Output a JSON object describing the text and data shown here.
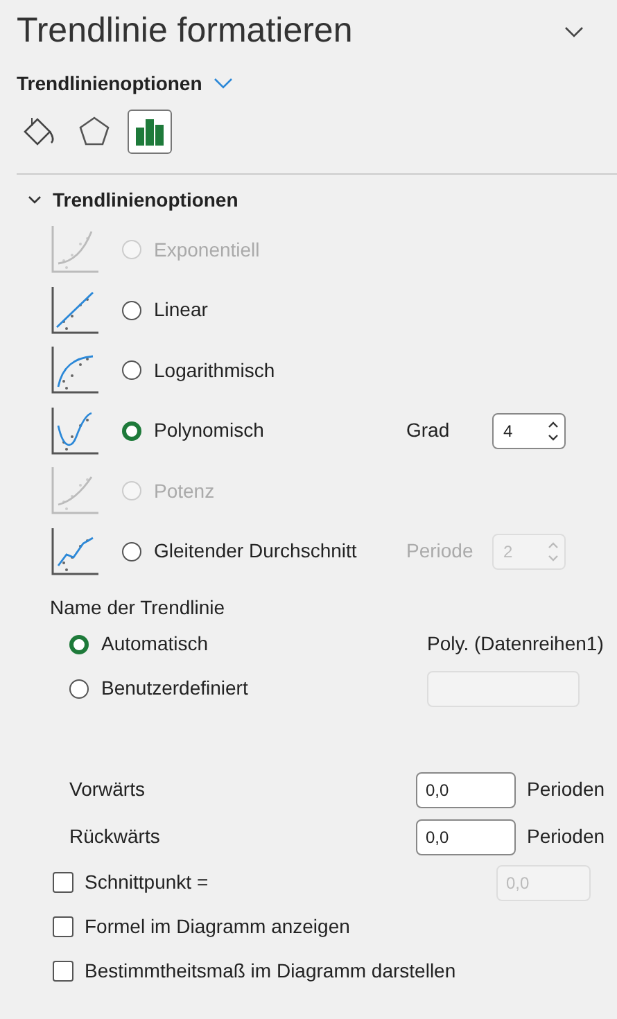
{
  "title": "Trendlinie formatieren",
  "subtitle": "Trendlinienoptionen",
  "tab_icons": [
    {
      "kind": "fill",
      "selected": false
    },
    {
      "kind": "shape",
      "selected": false
    },
    {
      "kind": "chart",
      "selected": true
    }
  ],
  "section": {
    "title": "Trendlinienoptionen",
    "expanded": true
  },
  "trend_types": [
    {
      "kind": "exponential",
      "label": "Exponentiell",
      "selected": false,
      "disabled": true
    },
    {
      "kind": "linear",
      "label": "Linear",
      "selected": false,
      "disabled": false
    },
    {
      "kind": "logarithmic",
      "label": "Logarithmisch",
      "selected": false,
      "disabled": false
    },
    {
      "kind": "polynomial",
      "label": "Polynomisch",
      "selected": true,
      "disabled": false,
      "param": {
        "label": "Grad",
        "value": "4",
        "disabled": false
      }
    },
    {
      "kind": "power",
      "label": "Potenz",
      "selected": false,
      "disabled": true
    },
    {
      "kind": "moving_average",
      "label": "Gleitender Durchschnitt",
      "selected": false,
      "disabled": false,
      "param": {
        "label": "Periode",
        "value": "2",
        "disabled": true
      }
    }
  ],
  "name_label": "Name der Trendlinie",
  "name_options": [
    {
      "label": "Automatisch",
      "selected": true,
      "value": "Poly. (Datenreihen1)"
    },
    {
      "label": "Benutzerdefiniert",
      "selected": false,
      "field_disabled": true
    }
  ],
  "forecast": [
    {
      "label": "Vorwärts",
      "value": "0,0",
      "unit": "Perioden"
    },
    {
      "label": "Rückwärts",
      "value": "0,0",
      "unit": "Perioden"
    }
  ],
  "checks": [
    {
      "label": "Schnittpunkt =",
      "checked": false,
      "value": "0,0",
      "field_disabled": true
    },
    {
      "label": "Formel im Diagramm anzeigen",
      "checked": false
    },
    {
      "label": "Bestimmtheitsmaß im Diagramm darstellen",
      "checked": false
    }
  ]
}
